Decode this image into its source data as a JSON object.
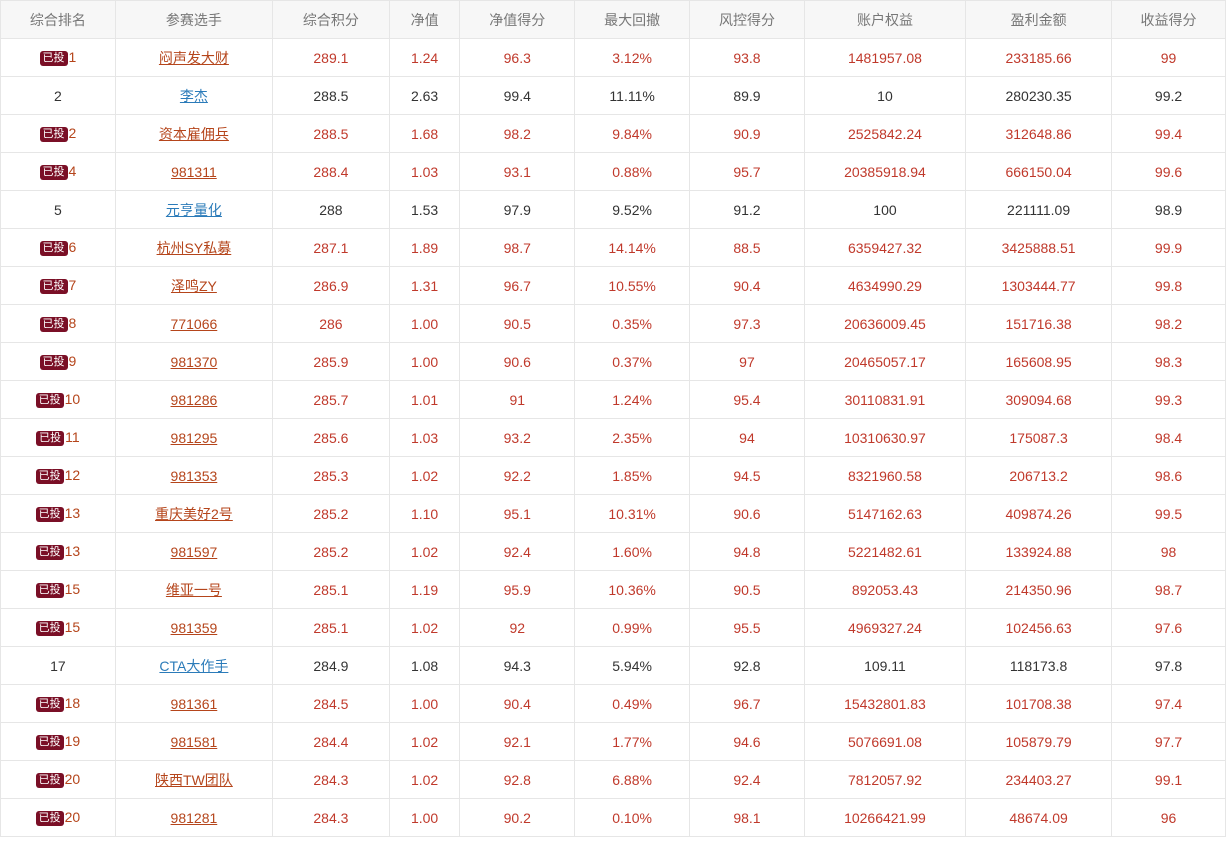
{
  "headers": [
    "综合排名",
    "参赛选手",
    "综合积分",
    "净值",
    "净值得分",
    "最大回撤",
    "风控得分",
    "账户权益",
    "盈利金额",
    "收益得分"
  ],
  "badge_label": "已投",
  "rows": [
    {
      "invested": true,
      "rank": "1",
      "name": "闷声发大财",
      "score": "289.1",
      "nav": "1.24",
      "nav_score": "96.3",
      "max_drawdown": "3.12%",
      "risk_score": "93.8",
      "equity": "1481957.08",
      "profit": "233185.66",
      "return_score": "99"
    },
    {
      "invested": false,
      "rank": "2",
      "name": "李杰",
      "score": "288.5",
      "nav": "2.63",
      "nav_score": "99.4",
      "max_drawdown": "11.11%",
      "risk_score": "89.9",
      "equity": "10",
      "profit": "280230.35",
      "return_score": "99.2"
    },
    {
      "invested": true,
      "rank": "2",
      "name": "资本雇佣兵",
      "score": "288.5",
      "nav": "1.68",
      "nav_score": "98.2",
      "max_drawdown": "9.84%",
      "risk_score": "90.9",
      "equity": "2525842.24",
      "profit": "312648.86",
      "return_score": "99.4"
    },
    {
      "invested": true,
      "rank": "4",
      "name": "981311",
      "score": "288.4",
      "nav": "1.03",
      "nav_score": "93.1",
      "max_drawdown": "0.88%",
      "risk_score": "95.7",
      "equity": "20385918.94",
      "profit": "666150.04",
      "return_score": "99.6"
    },
    {
      "invested": false,
      "rank": "5",
      "name": "元亨量化",
      "score": "288",
      "nav": "1.53",
      "nav_score": "97.9",
      "max_drawdown": "9.52%",
      "risk_score": "91.2",
      "equity": "100",
      "profit": "221111.09",
      "return_score": "98.9"
    },
    {
      "invested": true,
      "rank": "6",
      "name": "杭州SY私募",
      "score": "287.1",
      "nav": "1.89",
      "nav_score": "98.7",
      "max_drawdown": "14.14%",
      "risk_score": "88.5",
      "equity": "6359427.32",
      "profit": "3425888.51",
      "return_score": "99.9"
    },
    {
      "invested": true,
      "rank": "7",
      "name": "泽鸣ZY",
      "score": "286.9",
      "nav": "1.31",
      "nav_score": "96.7",
      "max_drawdown": "10.55%",
      "risk_score": "90.4",
      "equity": "4634990.29",
      "profit": "1303444.77",
      "return_score": "99.8"
    },
    {
      "invested": true,
      "rank": "8",
      "name": "771066",
      "score": "286",
      "nav": "1.00",
      "nav_score": "90.5",
      "max_drawdown": "0.35%",
      "risk_score": "97.3",
      "equity": "20636009.45",
      "profit": "151716.38",
      "return_score": "98.2"
    },
    {
      "invested": true,
      "rank": "9",
      "name": "981370",
      "score": "285.9",
      "nav": "1.00",
      "nav_score": "90.6",
      "max_drawdown": "0.37%",
      "risk_score": "97",
      "equity": "20465057.17",
      "profit": "165608.95",
      "return_score": "98.3"
    },
    {
      "invested": true,
      "rank": "10",
      "name": "981286",
      "score": "285.7",
      "nav": "1.01",
      "nav_score": "91",
      "max_drawdown": "1.24%",
      "risk_score": "95.4",
      "equity": "30110831.91",
      "profit": "309094.68",
      "return_score": "99.3"
    },
    {
      "invested": true,
      "rank": "11",
      "name": "981295",
      "score": "285.6",
      "nav": "1.03",
      "nav_score": "93.2",
      "max_drawdown": "2.35%",
      "risk_score": "94",
      "equity": "10310630.97",
      "profit": "175087.3",
      "return_score": "98.4"
    },
    {
      "invested": true,
      "rank": "12",
      "name": "981353",
      "score": "285.3",
      "nav": "1.02",
      "nav_score": "92.2",
      "max_drawdown": "1.85%",
      "risk_score": "94.5",
      "equity": "8321960.58",
      "profit": "206713.2",
      "return_score": "98.6"
    },
    {
      "invested": true,
      "rank": "13",
      "name": "重庆美好2号",
      "score": "285.2",
      "nav": "1.10",
      "nav_score": "95.1",
      "max_drawdown": "10.31%",
      "risk_score": "90.6",
      "equity": "5147162.63",
      "profit": "409874.26",
      "return_score": "99.5"
    },
    {
      "invested": true,
      "rank": "13",
      "name": "981597",
      "score": "285.2",
      "nav": "1.02",
      "nav_score": "92.4",
      "max_drawdown": "1.60%",
      "risk_score": "94.8",
      "equity": "5221482.61",
      "profit": "133924.88",
      "return_score": "98"
    },
    {
      "invested": true,
      "rank": "15",
      "name": "维亚一号",
      "score": "285.1",
      "nav": "1.19",
      "nav_score": "95.9",
      "max_drawdown": "10.36%",
      "risk_score": "90.5",
      "equity": "892053.43",
      "profit": "214350.96",
      "return_score": "98.7"
    },
    {
      "invested": true,
      "rank": "15",
      "name": "981359",
      "score": "285.1",
      "nav": "1.02",
      "nav_score": "92",
      "max_drawdown": "0.99%",
      "risk_score": "95.5",
      "equity": "4969327.24",
      "profit": "102456.63",
      "return_score": "97.6"
    },
    {
      "invested": false,
      "rank": "17",
      "name": "CTA大作手",
      "score": "284.9",
      "nav": "1.08",
      "nav_score": "94.3",
      "max_drawdown": "5.94%",
      "risk_score": "92.8",
      "equity": "109.11",
      "profit": "118173.8",
      "return_score": "97.8"
    },
    {
      "invested": true,
      "rank": "18",
      "name": "981361",
      "score": "284.5",
      "nav": "1.00",
      "nav_score": "90.4",
      "max_drawdown": "0.49%",
      "risk_score": "96.7",
      "equity": "15432801.83",
      "profit": "101708.38",
      "return_score": "97.4"
    },
    {
      "invested": true,
      "rank": "19",
      "name": "981581",
      "score": "284.4",
      "nav": "1.02",
      "nav_score": "92.1",
      "max_drawdown": "1.77%",
      "risk_score": "94.6",
      "equity": "5076691.08",
      "profit": "105879.79",
      "return_score": "97.7"
    },
    {
      "invested": true,
      "rank": "20",
      "name": "陕西TW团队",
      "score": "284.3",
      "nav": "1.02",
      "nav_score": "92.8",
      "max_drawdown": "6.88%",
      "risk_score": "92.4",
      "equity": "7812057.92",
      "profit": "234403.27",
      "return_score": "99.1"
    },
    {
      "invested": true,
      "rank": "20",
      "name": "981281",
      "score": "284.3",
      "nav": "1.00",
      "nav_score": "90.2",
      "max_drawdown": "0.10%",
      "risk_score": "98.1",
      "equity": "10266421.99",
      "profit": "48674.09",
      "return_score": "96"
    }
  ]
}
